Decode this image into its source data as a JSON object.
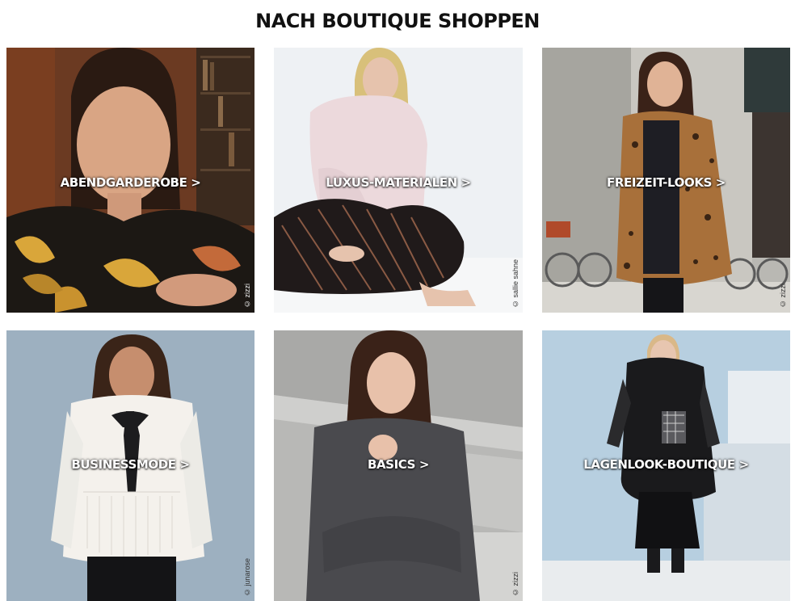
{
  "heading": "NACH BOUTIQUE SHOPPEN",
  "tiles": [
    {
      "label": "ABENDGARDEROBE >",
      "credit": "© zizzi",
      "image": "woman-floral-blouse-evening-wear"
    },
    {
      "label": "LUXUS-MATERIALEN >",
      "credit": "© sallie sahne",
      "image": "woman-pink-sweater-striped-skirt"
    },
    {
      "label": "FREIZEIT-LOOKS >",
      "credit": "© zizzi",
      "image": "woman-leopard-coat-street"
    },
    {
      "label": "BUSINESSMODE >",
      "credit": "© junarose",
      "image": "woman-white-blouse-bow"
    },
    {
      "label": "BASICS >",
      "credit": "© zizzi",
      "image": "woman-grey-knit-sweater"
    },
    {
      "label": "LAGENLOOK-BOUTIQUE >",
      "credit": "",
      "image": "woman-black-layered-coat"
    }
  ],
  "colors": {
    "background": "#ffffff",
    "heading": "#111111",
    "label": "#ffffff"
  }
}
